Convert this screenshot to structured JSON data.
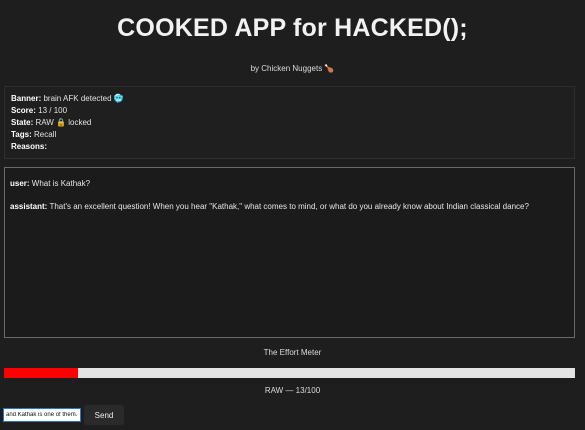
{
  "header": {
    "title": "COOKED APP for HACKED();",
    "byline": "by Chicken Nuggets 🍗"
  },
  "status": {
    "banner_label": "Banner:",
    "banner_value": "brain AFK detected 🥶",
    "score_label": "Score:",
    "score_value": "13 / 100",
    "state_label": "State:",
    "state_value": "RAW 🔒 locked",
    "tags_label": "Tags:",
    "tags_value": "Recall",
    "reasons_label": "Reasons:",
    "reasons_value": ""
  },
  "chat": {
    "messages": [
      {
        "role": "user:",
        "text": "What is Kathak?"
      },
      {
        "role": "assistant:",
        "text": "That's an excellent question! When you hear \"Kathak,\" what comes to mind, or what do you already know about Indian classical dance?"
      }
    ]
  },
  "meter": {
    "label": "The Effort Meter",
    "score": 13,
    "max": 100,
    "readout": "RAW — 13/100",
    "fill_color": "#ff0000",
    "track_color": "#e4e4e4"
  },
  "composer": {
    "input_value": "and Kathak is one of them.",
    "send_label": "Send"
  }
}
